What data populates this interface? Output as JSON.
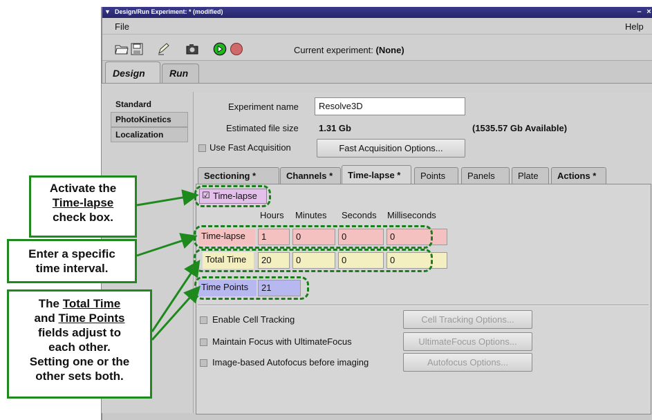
{
  "window": {
    "title": "Design/Run Experiment:  * (modified)",
    "menu": {
      "file": "File",
      "help": "Help"
    }
  },
  "toolbar": {
    "current_label": "Current experiment:",
    "current_value": "(None)"
  },
  "main_tabs": {
    "design": "Design",
    "run": "Run"
  },
  "left_list": [
    "Standard",
    "PhotoKinetics",
    "Localization"
  ],
  "experiment": {
    "name_label": "Experiment name",
    "name_value": "Resolve3D",
    "size_label": "Estimated file size",
    "size_value": "1.31 Gb",
    "available": "(1535.57 Gb Available)",
    "fast_acq_label": "Use Fast Acquisition",
    "fast_acq_button": "Fast Acquisition Options..."
  },
  "sub_tabs": [
    "Sectioning *",
    "Channels *",
    "Time-lapse *",
    "Points",
    "Panels",
    "Plate",
    "Actions *"
  ],
  "timelapse": {
    "checkbox_label": "Time-lapse",
    "col_headers": [
      "Hours",
      "Minutes",
      "Seconds",
      "Milliseconds"
    ],
    "interval_label": "Time-lapse",
    "interval_values": [
      "1",
      "0",
      "0",
      "0"
    ],
    "total_label": "Total Time",
    "total_values": [
      "20",
      "0",
      "0",
      "0"
    ],
    "points_label": "Time Points",
    "points_value": "21"
  },
  "options": {
    "cell_tracking_label": "Enable Cell Tracking",
    "cell_tracking_button": "Cell Tracking Options...",
    "focus_label": "Maintain Focus with UltimateFocus",
    "focus_button": "UltimateFocus Options...",
    "autofocus_label": "Image-based Autofocus before imaging",
    "autofocus_button": "Autofocus Options..."
  },
  "callouts": {
    "c1_pre": "Activate the",
    "c1_u": "Time-lapse",
    "c1_post": "check box.",
    "c2_l1": "Enter a specific",
    "c2_l2": "time interval.",
    "c3_the": "The",
    "c3_u1": "Total Time",
    "c3_and": "and",
    "c3_u2": "Time Points",
    "c3_l3": "fields adjust to",
    "c3_l4": "each other.",
    "c3_l5": "Setting one or the",
    "c3_l6": "other sets both."
  },
  "colors": {
    "accent_green": "#1e8a1e",
    "highlight_pink": "#f4c0c0",
    "highlight_yellow": "#f3efc0",
    "highlight_blue": "#b8b8f0"
  }
}
